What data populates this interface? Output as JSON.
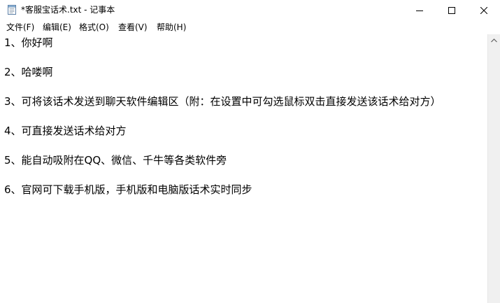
{
  "window": {
    "title": "*客服宝话术.txt - 记事本"
  },
  "titlebar": {
    "icons": {
      "app": "notepad-icon",
      "minimize": "minimize-icon",
      "maximize": "maximize-icon",
      "close": "close-icon"
    }
  },
  "menu": {
    "items": [
      {
        "label": "文件(F)"
      },
      {
        "label": "编辑(E)"
      },
      {
        "label": "格式(O)"
      },
      {
        "label": "查看(V)"
      },
      {
        "label": "帮助(H)"
      }
    ]
  },
  "editor": {
    "lines": [
      "1、你好啊",
      "2、哈喽啊",
      "3、可将该话术发送到聊天软件编辑区（附：在设置中可勾选鼠标双击直接发送该话术给对方）",
      "4、可直接发送话术给对方",
      "5、能自动吸附在QQ、微信、千牛等各类软件旁",
      "6、官网可下载手机版，手机版和电脑版话术实时同步"
    ]
  },
  "scrollbar": {
    "icon": "scroll-up-arrow-icon"
  }
}
